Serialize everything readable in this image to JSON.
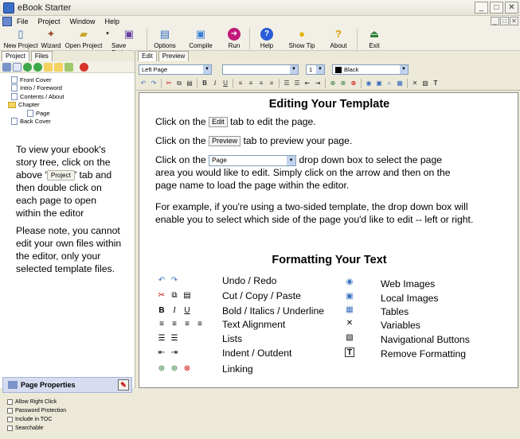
{
  "window": {
    "title": "eBook Starter",
    "min": "_",
    "max": "□",
    "close": "✕"
  },
  "menu": [
    "File",
    "Project",
    "Window",
    "Help"
  ],
  "toolbar": [
    {
      "label": "New Project",
      "icon": "new-project-icon",
      "glyph": "🗋",
      "color": "#3a6fbf"
    },
    {
      "label": "Wizard",
      "icon": "wizard-icon",
      "glyph": "✦",
      "color": "#a0522d"
    },
    {
      "label": "Open Project",
      "icon": "open-folder-icon",
      "glyph": "📂",
      "color": "#c9a227"
    },
    {
      "label": "Save Project",
      "icon": "save-icon",
      "glyph": "💾",
      "color": "#6a3fa0"
    },
    {
      "label": "Options",
      "icon": "options-icon",
      "glyph": "▤",
      "color": "#2b6cc4"
    },
    {
      "label": "Compile",
      "icon": "compile-icon",
      "glyph": "▣",
      "color": "#3a7fd5"
    },
    {
      "label": "Run",
      "icon": "run-icon",
      "glyph": "➜",
      "color": "#c2187a"
    },
    {
      "label": "Help",
      "icon": "help-icon",
      "glyph": "?",
      "color": "#2a5bd7"
    },
    {
      "label": "Show Tip",
      "icon": "lightbulb-icon",
      "glyph": "💡",
      "color": "#e2b400"
    },
    {
      "label": "About",
      "icon": "about-icon",
      "glyph": "?",
      "color": "#d69b00"
    },
    {
      "label": "Exit",
      "icon": "exit-icon",
      "glyph": "⏏",
      "color": "#2a7f3a"
    }
  ],
  "left_tabs": [
    "Project",
    "Files"
  ],
  "tree": [
    {
      "label": "Front Cover",
      "type": "page",
      "indent": 1
    },
    {
      "label": "Intro / Foreword",
      "type": "page",
      "indent": 1
    },
    {
      "label": "Contents / About",
      "type": "page",
      "indent": 1
    },
    {
      "label": "Chapter",
      "type": "folder",
      "indent": 1
    },
    {
      "label": "Page",
      "type": "page",
      "indent": 2
    },
    {
      "label": "Back Cover",
      "type": "page",
      "indent": 1
    }
  ],
  "help": {
    "p1_a": "To view your ebook's story tree, click on the above '",
    "p1_btn": "Project",
    "p1_b": "' tab and then double click on each page to open within the editor",
    "p2": "Please note, you cannot edit your own files within the editor, only your selected template files."
  },
  "page_properties": {
    "title": "Page Properties",
    "items": [
      "Allow Right Click",
      "Password Protection",
      "Include in TOC",
      "Searchable"
    ]
  },
  "editor_tabs": [
    "Edit",
    "Preview"
  ],
  "format": {
    "section": "Left Page",
    "font": "",
    "size": "1",
    "color": "Black"
  },
  "content": {
    "heading1": "Editing Your Template",
    "l1_a": "Click on the",
    "l1_chip": "Edit",
    "l1_b": "tab to edit the page.",
    "l2_a": "Click on the",
    "l2_chip": "Preview",
    "l2_b": "tab to preview your page.",
    "l3_a": "Click on the",
    "l3_sel": "Page",
    "l3_b": "drop down box to select the page",
    "l3_c": "area you would like to edit. Simply click on the arrow and then on the",
    "l3_d": "page name to load the page within the editor.",
    "l4_a": "For example, if you're using a two-sided template, the drop down box will",
    "l4_b": "enable you to select which side of the page you'd like to edit -- left or right.",
    "heading2": "Formatting Your Text",
    "left_features": [
      "Undo / Redo",
      "Cut / Copy / Paste",
      "Bold / Italics / Underline",
      "Text Alignment",
      "Lists",
      "Indent / Outdent",
      "Linking"
    ],
    "right_features": [
      "Web Images",
      "Local Images",
      "Tables",
      "Variables",
      "Navigational Buttons",
      "Remove Formatting"
    ]
  }
}
